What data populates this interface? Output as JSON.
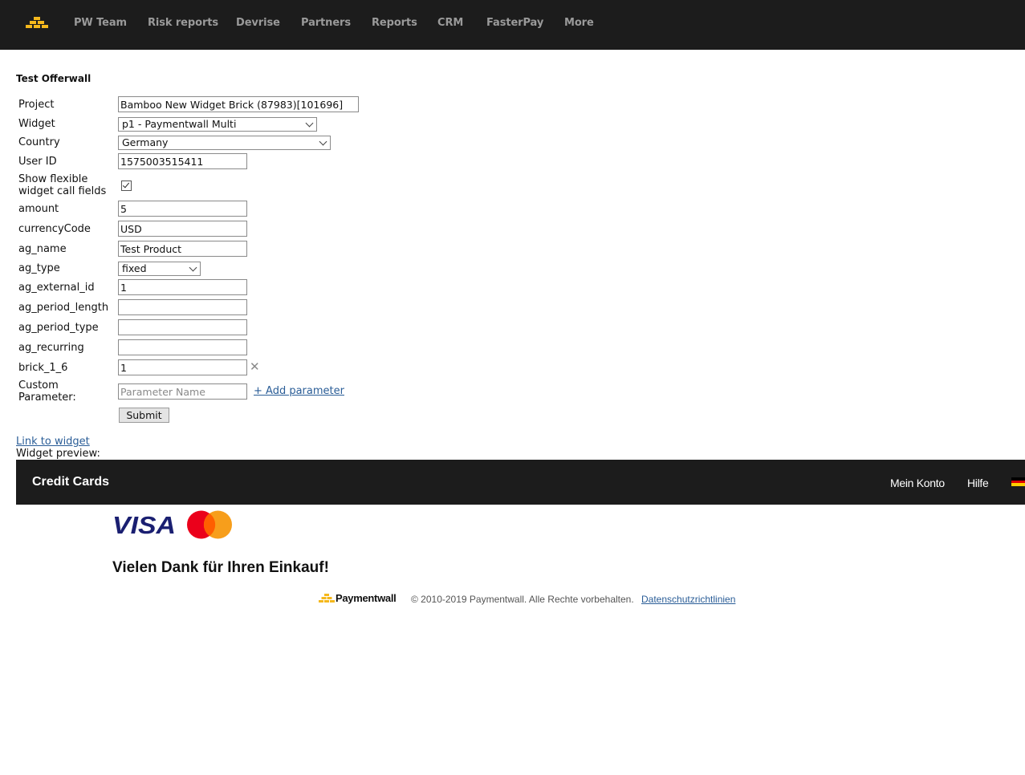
{
  "nav": {
    "logo_icon": "paymentwall-bars-logo",
    "items": [
      {
        "label": "PW Team"
      },
      {
        "label": "Risk reports"
      },
      {
        "label": "Devrise"
      },
      {
        "label": "Partners"
      },
      {
        "label": "Reports"
      },
      {
        "label": "CRM"
      },
      {
        "label": "FasterPay"
      },
      {
        "label": "More"
      }
    ]
  },
  "form": {
    "title": "Test Offerwall",
    "project": {
      "label": "Project",
      "value": "Bamboo New Widget Brick (87983)[101696]"
    },
    "widget": {
      "label": "Widget",
      "value": "p1 - Paymentwall Multi"
    },
    "country": {
      "label": "Country",
      "value": "Germany"
    },
    "user_id": {
      "label": "User ID",
      "value": "1575003515411"
    },
    "flexible": {
      "label_line1": "Show flexible",
      "label_line2": "widget call fields",
      "checked": true
    },
    "amount": {
      "label": "amount",
      "value": "5"
    },
    "currency": {
      "label": "currencyCode",
      "value": "USD"
    },
    "ag_name": {
      "label": "ag_name",
      "value": "Test Product"
    },
    "ag_type": {
      "label": "ag_type",
      "value": "fixed"
    },
    "ag_external_id": {
      "label": "ag_external_id",
      "value": "1"
    },
    "ag_period_length": {
      "label": "ag_period_length",
      "value": ""
    },
    "ag_period_type": {
      "label": "ag_period_type",
      "value": ""
    },
    "ag_recurring": {
      "label": "ag_recurring",
      "value": ""
    },
    "brick": {
      "label": "brick_1_6",
      "value": "1"
    },
    "custom": {
      "label_line1": "Custom",
      "label_line2": "Parameter:",
      "placeholder": "Parameter Name",
      "add_label": "+ Add parameter"
    },
    "submit_label": "Submit",
    "link_to_widget": "Link to widget",
    "widget_preview": "Widget preview:"
  },
  "widget_preview": {
    "title": "Credit Cards",
    "account_link": "Mein Konto",
    "help_link": "Hilfe",
    "flag_colors": [
      "#000000",
      "#dd0000",
      "#ffce00"
    ],
    "visa_text": "VISA",
    "visa_color": "#1a1f71",
    "mastercard_colors": [
      "#eb001b",
      "#f79e1b",
      "#ff5f00"
    ],
    "thanks": "Vielen Dank für Ihren Einkauf!",
    "brand": "Paymentwall",
    "copyright": "© 2010-2019 Paymentwall. Alle Rechte vorbehalten.",
    "privacy_link": "Datenschutzrichtlinien"
  },
  "colors": {
    "nav_bg": "#1c1c1c",
    "nav_text": "#9a9a9a",
    "logo_yellow": "#f5b81c",
    "link": "#2a5d97"
  }
}
